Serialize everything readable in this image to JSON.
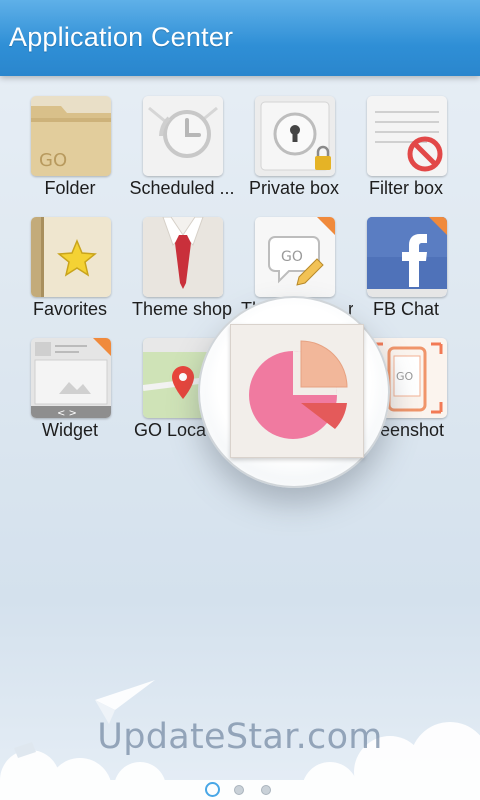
{
  "header": {
    "title": "Application Center"
  },
  "apps": [
    {
      "label": "Folder",
      "icon": "folder-icon"
    },
    {
      "label": "Scheduled ...",
      "icon": "clock-icon"
    },
    {
      "label": "Private box",
      "icon": "keyhole-lock-icon"
    },
    {
      "label": "Filter box",
      "icon": "filter-block-icon"
    },
    {
      "label": "Favorites",
      "icon": "star-book-icon"
    },
    {
      "label": "Theme shop",
      "icon": "shirt-tie-icon"
    },
    {
      "label": "Th",
      "label_tail": "r",
      "icon": "go-pencil-icon"
    },
    {
      "label": "FB Chat",
      "icon": "facebook-icon"
    },
    {
      "label": "Widget",
      "icon": "widget-icon"
    },
    {
      "label": "GO Loca",
      "icon": "map-pin-icon"
    },
    {
      "label": "reenshot",
      "icon": "phone-screenshot-icon"
    }
  ],
  "magnifier": {
    "icon": "pie-chart-icon"
  },
  "watermark": "UpdateStar.com",
  "pager": {
    "pages": 3,
    "current": 1
  },
  "colors": {
    "header": "#2f8fd6",
    "badge": "#f08a3c",
    "pie_pink": "#f07aa0",
    "pie_peach": "#f2b79a",
    "pie_red": "#e45a5a",
    "facebook": "#3b5da6"
  }
}
